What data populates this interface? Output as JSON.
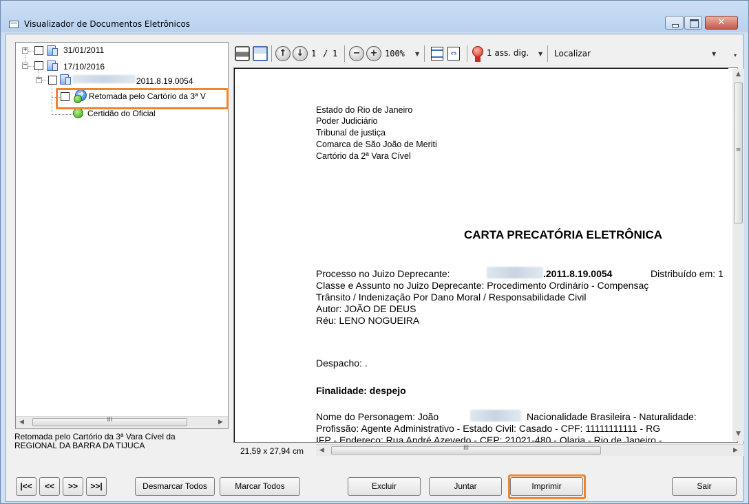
{
  "window": {
    "title": "Visualizador de Documentos Eletrônicos"
  },
  "tree": {
    "nodes": [
      {
        "label": "31/01/2011"
      },
      {
        "label": "17/10/2016"
      },
      {
        "label": "2011.8.19.0054"
      },
      {
        "label": "Retomada pelo Cartório da 3ª V"
      },
      {
        "label": "Certidão do Oficial"
      }
    ]
  },
  "status_left": {
    "line1": "Retomada pelo Cartório da 3ª Vara Cível da",
    "line2": "REGIONAL DA BARRA DA TIJUCA"
  },
  "toolbar": {
    "page_current": "1",
    "page_sep": "/",
    "page_total": "1",
    "zoom": "100%",
    "signatures": "1 ass. dig.",
    "search_placeholder": "Localizar"
  },
  "document": {
    "header": [
      "Estado do Rio de Janeiro",
      "Poder Judiciário",
      "Tribunal de justiça",
      "Comarca de São João de Meriti",
      "Cartório da 2ª Vara Cível"
    ],
    "title": "CARTA PRECATÓRIA ELETRÔNICA",
    "processo_label": "Processo no Juizo Deprecante:",
    "processo_num": ".2011.8.19.0054",
    "distribuido": "Distribuído em: 1",
    "classe": "Classe e Assunto no Juizo Deprecante: Procedimento Ordinário - Compensaç",
    "transito": "Trânsito / Indenização Por Dano Moral / Responsabilidade Civil",
    "autor": "Autor: JOÃO DE DEUS",
    "reu": "Réu: LENO NOGUEIRA",
    "despacho": "Despacho: .",
    "finalidade": "Finalidade: despejo",
    "nome_label": "Nome do Personagem: João",
    "nome_rest": "Nacionalidade Brasileira - Naturalidade:",
    "profissao": "Profissão: Agente Administrativo - Estado Civil: Casado - CPF: 11111111111 - RG",
    "endereco": "IFP - Endereço: Rua André Azevedo  - CEP: 21021-480 - Olaria - Rio de Janeiro -"
  },
  "page_size": "21,59 x 27,94 cm",
  "buttons": {
    "first": "|<<",
    "prev": "<<",
    "next": ">>",
    "last": ">>|",
    "desmarcar": "Desmarcar Todos",
    "marcar": "Marcar Todos",
    "excluir": "Excluir",
    "juntar": "Juntar",
    "imprimir": "Imprimir",
    "sair": "Sair"
  },
  "colors": {
    "highlight": "#f0852d"
  }
}
